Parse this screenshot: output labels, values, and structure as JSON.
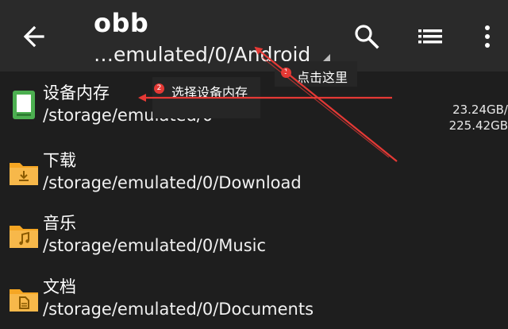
{
  "appbar": {
    "title": "obb",
    "subtitle": "…emulated/0/Android",
    "back_icon": "arrow-left-icon",
    "search_icon": "search-icon",
    "list_view_icon": "list-view-icon",
    "more_icon": "more-vert-icon"
  },
  "rows": [
    {
      "name": "设备内存",
      "path": "/storage/emulated/0",
      "icon": "phone-storage-icon",
      "free": "23.24GB/",
      "total": "225.42GB"
    },
    {
      "name": "下载",
      "path": "/storage/emulated/0/Download",
      "icon": "download-folder-icon"
    },
    {
      "name": "音乐",
      "path": "/storage/emulated/0/Music",
      "icon": "music-folder-icon"
    },
    {
      "name": "文档",
      "path": "/storage/emulated/0/Documents",
      "icon": "documents-folder-icon"
    }
  ],
  "annotations": [
    {
      "number": "1",
      "text": "点击这里"
    },
    {
      "number": "2",
      "text": "选择设备内存"
    }
  ],
  "colors": {
    "background": "#1e1e1e",
    "appbar": "#2a2a2a",
    "folder": "#f5a623",
    "storage_icon": "#4caf50",
    "annotation_arrow": "#e53935"
  }
}
